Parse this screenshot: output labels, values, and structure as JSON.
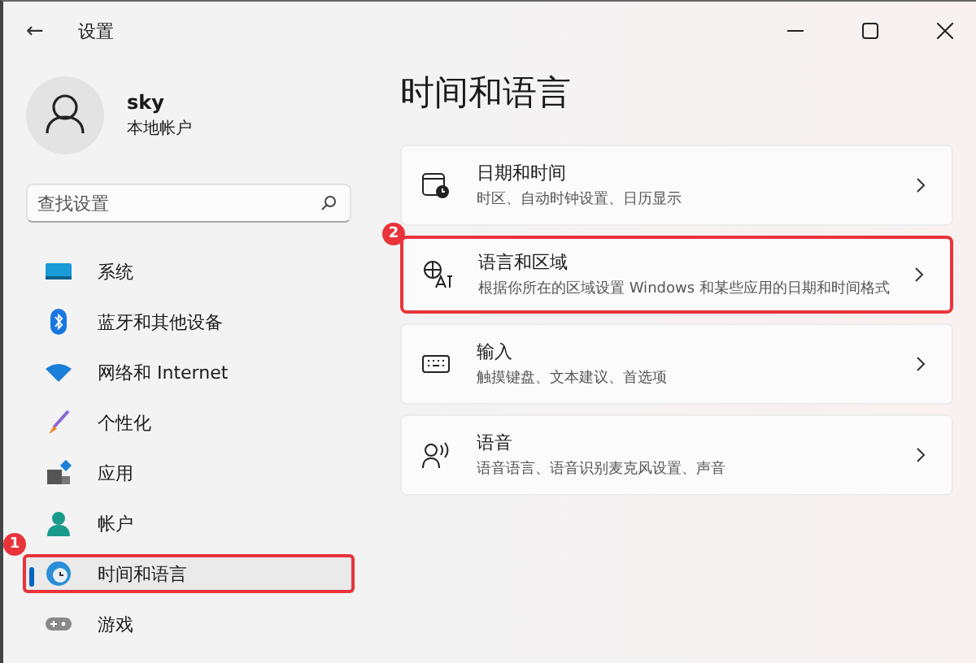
{
  "window": {
    "title": "设置",
    "back_icon": "←"
  },
  "profile": {
    "name": "sky",
    "account": "本地帐户"
  },
  "search": {
    "placeholder": "查找设置"
  },
  "sidebar": {
    "items": [
      {
        "label": "系统",
        "kind": "system",
        "selected": false,
        "highlighted": false
      },
      {
        "label": "蓝牙和其他设备",
        "kind": "bluetooth",
        "selected": false,
        "highlighted": false
      },
      {
        "label": "网络和 Internet",
        "kind": "network",
        "selected": false,
        "highlighted": false
      },
      {
        "label": "个性化",
        "kind": "brush",
        "selected": false,
        "highlighted": false
      },
      {
        "label": "应用",
        "kind": "apps",
        "selected": false,
        "highlighted": false
      },
      {
        "label": "帐户",
        "kind": "account",
        "selected": false,
        "highlighted": false
      },
      {
        "label": "时间和语言",
        "kind": "time",
        "selected": true,
        "highlighted": true,
        "marker": "1"
      },
      {
        "label": "游戏",
        "kind": "game",
        "selected": false,
        "highlighted": false
      }
    ]
  },
  "page": {
    "title": "时间和语言",
    "cards": [
      {
        "title": "日期和时间",
        "description": "时区、自动时钟设置、日历显示",
        "kind": "calendar",
        "highlighted": false
      },
      {
        "title": "语言和区域",
        "description": "根据你所在的区域设置 Windows 和某些应用的日期和时间格式",
        "kind": "language",
        "highlighted": true,
        "marker": "2"
      },
      {
        "title": "输入",
        "description": "触摸键盘、文本建议、首选项",
        "kind": "keyboard",
        "highlighted": false
      },
      {
        "title": "语音",
        "description": "语音语言、语音识别麦克风设置、声音",
        "kind": "speech",
        "highlighted": false
      }
    ]
  }
}
